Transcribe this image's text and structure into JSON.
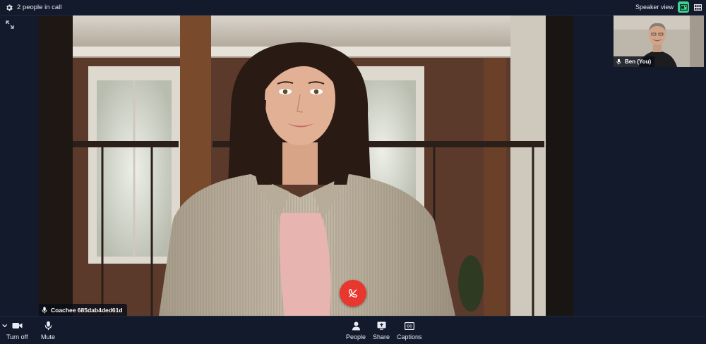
{
  "topbar": {
    "participants_label": "2 people in call",
    "view_label": "Speaker view",
    "icons": [
      "gear-icon",
      "speaker-view-icon",
      "grid-view-icon"
    ],
    "active_view_color": "#3fcf8e"
  },
  "stage": {
    "expand_icon": "expand-icon",
    "main_participant": {
      "name": "Coachee 685dab4ded61d",
      "mic_icon": "microphone-icon"
    },
    "self_participant": {
      "name": "Ben (You)",
      "mic_icon": "microphone-icon"
    },
    "hangup": {
      "icon": "phone-hangup-icon",
      "color": "#e8372e"
    }
  },
  "bottombar": {
    "camera": {
      "label": "Turn off",
      "icon": "video-camera-icon"
    },
    "mic": {
      "label": "Mute",
      "icon": "microphone-icon"
    },
    "people": {
      "label": "People",
      "icon": "person-icon"
    },
    "share": {
      "label": "Share",
      "icon": "screen-share-icon"
    },
    "captions": {
      "label": "Captions",
      "icon": "closed-captions-icon"
    }
  }
}
